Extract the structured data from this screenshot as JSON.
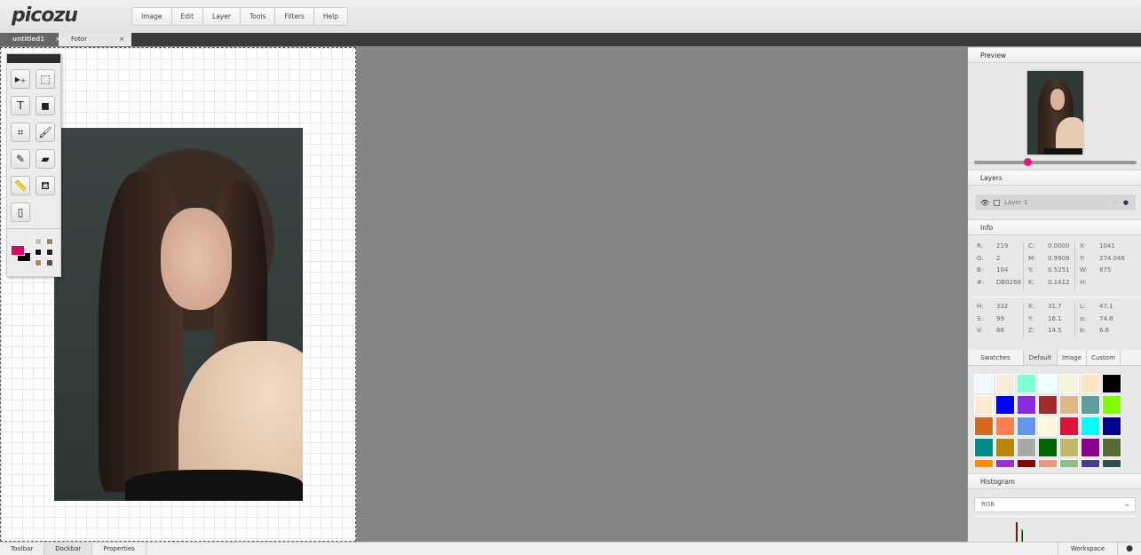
{
  "app": {
    "logo": "picozu"
  },
  "menu": [
    "Image",
    "Edit",
    "Layer",
    "Tools",
    "Filters",
    "Help"
  ],
  "tabs": [
    {
      "label": "untitled1",
      "close": "×"
    },
    {
      "label": "Fotor after.jpg",
      "close": "×"
    }
  ],
  "tools": [
    [
      "move-tool",
      "▸₊"
    ],
    [
      "select-tool",
      "⬚"
    ],
    [
      "text-tool",
      "T"
    ],
    [
      "shape-tool",
      "◼"
    ],
    [
      "crop-tool",
      "⌗"
    ],
    [
      "brush-tool",
      "🖌"
    ],
    [
      "eyedropper-tool",
      "✎"
    ],
    [
      "eraser-tool",
      "▰"
    ],
    [
      "ruler-tool",
      "📏"
    ],
    [
      "fill-tool",
      "⛾"
    ],
    [
      "spray-tool",
      "▯"
    ]
  ],
  "colors": {
    "foreground": "#DB0268",
    "background": "#000000",
    "mini": [
      "#cbbcaa",
      "#9c8470",
      "#111111",
      "#222222",
      "#a68c78",
      "#5c4e44"
    ]
  },
  "panels": {
    "preview": "Preview",
    "layers": "Layers",
    "info": "Info",
    "histogram": "Histogram"
  },
  "preview": {
    "zoom": 0.33
  },
  "layer": {
    "name": "Layer 1"
  },
  "info": {
    "col1": [
      [
        "R:",
        "219"
      ],
      [
        "G:",
        "2"
      ],
      [
        "B:",
        "104"
      ],
      [
        "#:",
        "DB0268"
      ]
    ],
    "col2": [
      [
        "C:",
        "0.0000"
      ],
      [
        "M:",
        "0.9909"
      ],
      [
        "Y:",
        "0.5251"
      ],
      [
        "K:",
        "0.1412"
      ]
    ],
    "col3": [
      [
        "X:",
        "1041"
      ],
      [
        "Y:",
        "274.046"
      ],
      [
        "W:",
        "875"
      ],
      [
        "H:",
        ""
      ]
    ],
    "col4": [
      [
        "H:",
        "332"
      ],
      [
        "S:",
        "99"
      ],
      [
        "V:",
        "86"
      ]
    ],
    "col5": [
      [
        "X:",
        "31.7"
      ],
      [
        "Y:",
        "16.1"
      ],
      [
        "Z:",
        "14.5"
      ]
    ],
    "col6": [
      [
        "L:",
        "47.1"
      ],
      [
        "a:",
        "74.8"
      ],
      [
        "b:",
        "6.6"
      ]
    ]
  },
  "swatch_tabs": [
    "Swatches",
    "Default",
    "Image",
    "Custom"
  ],
  "swatches": [
    "#F0F8FF",
    "#FAEBD7",
    "#7FFFD4",
    "#F0FFFF",
    "#F5F5DC",
    "#FFE4C4",
    "#000000",
    "#FFEBCD",
    "#0000FF",
    "#8A2BE2",
    "#A52A2A",
    "#DEB887",
    "#5F9EA0",
    "#7FFF00",
    "#D2691E",
    "#FF7F50",
    "#6495ED",
    "#FFF8DC",
    "#DC143C",
    "#00FFFF",
    "#00008B",
    "#008B8B",
    "#B8860B",
    "#A9A9A9",
    "#006400",
    "#BDB76B",
    "#8B008B",
    "#556B2F",
    "#FF8C00",
    "#9932CC",
    "#8B0000",
    "#E9967A",
    "#8FBC8F",
    "#483D8B",
    "#2F4F4F"
  ],
  "histogram": {
    "channel": "RGB"
  },
  "bottom": {
    "toolbar": "Toolbar",
    "dockbar": "Dockbar",
    "properties": "Properties",
    "workspace": "Workspace"
  }
}
